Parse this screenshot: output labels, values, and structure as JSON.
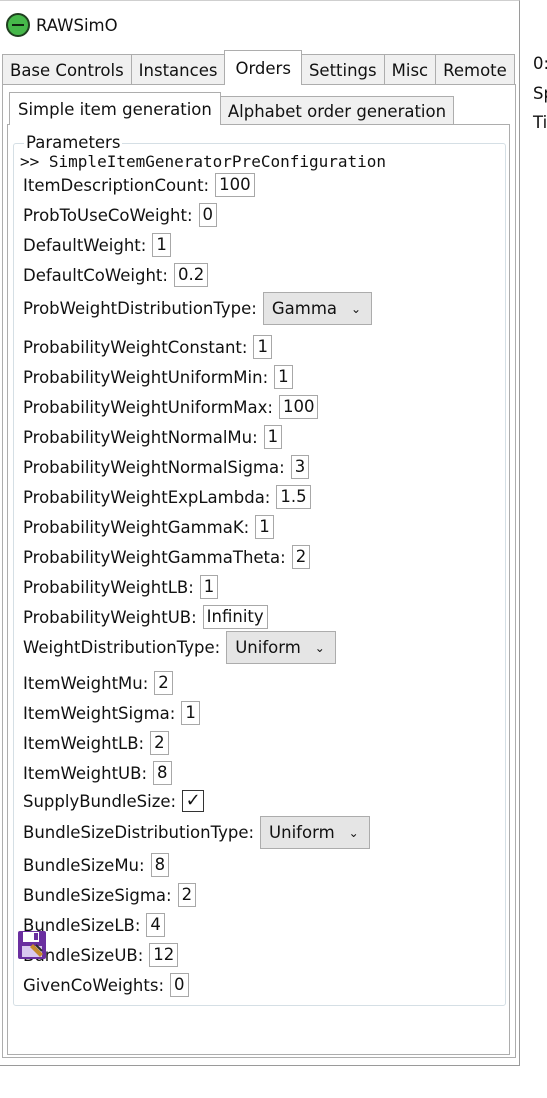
{
  "app": {
    "title": "RAWSimO"
  },
  "top_tabs": [
    "Base Controls",
    "Instances",
    "Orders",
    "Settings",
    "Misc",
    "Remote"
  ],
  "sub_tabs": [
    "Simple item generation",
    "Alphabet order generation"
  ],
  "group": {
    "legend": "Parameters",
    "config_header": ">> SimpleItemGeneratorPreConfiguration"
  },
  "params": {
    "item_description_count": {
      "label": "ItemDescriptionCount:",
      "value": "100"
    },
    "prob_to_use_co_weight": {
      "label": "ProbToUseCoWeight:",
      "value": "0"
    },
    "default_weight": {
      "label": "DefaultWeight:",
      "value": "1"
    },
    "default_co_weight": {
      "label": "DefaultCoWeight:",
      "value": "0.2"
    },
    "prob_weight_distribution_type": {
      "label": "ProbWeightDistributionType:",
      "value": "Gamma"
    },
    "probability_weight_constant": {
      "label": "ProbabilityWeightConstant:",
      "value": "1"
    },
    "probability_weight_uniform_min": {
      "label": "ProbabilityWeightUniformMin:",
      "value": "1"
    },
    "probability_weight_uniform_max": {
      "label": "ProbabilityWeightUniformMax:",
      "value": "100"
    },
    "probability_weight_normal_mu": {
      "label": "ProbabilityWeightNormalMu:",
      "value": "1"
    },
    "probability_weight_normal_sigma": {
      "label": "ProbabilityWeightNormalSigma:",
      "value": "3"
    },
    "probability_weight_exp_lambda": {
      "label": "ProbabilityWeightExpLambda:",
      "value": "1.5"
    },
    "probability_weight_gamma_k": {
      "label": "ProbabilityWeightGammaK:",
      "value": "1"
    },
    "probability_weight_gamma_theta": {
      "label": "ProbabilityWeightGammaTheta:",
      "value": "2"
    },
    "probability_weight_lb": {
      "label": "ProbabilityWeightLB:",
      "value": "1"
    },
    "probability_weight_ub": {
      "label": "ProbabilityWeightUB:",
      "value": "Infinity"
    },
    "weight_distribution_type": {
      "label": "WeightDistributionType:",
      "value": "Uniform"
    },
    "item_weight_mu": {
      "label": "ItemWeightMu:",
      "value": "2"
    },
    "item_weight_sigma": {
      "label": "ItemWeightSigma:",
      "value": "1"
    },
    "item_weight_lb": {
      "label": "ItemWeightLB:",
      "value": "2"
    },
    "item_weight_ub": {
      "label": "ItemWeightUB:",
      "value": "8"
    },
    "supply_bundle_size": {
      "label": "SupplyBundleSize:",
      "checked": true
    },
    "bundle_size_distribution_type": {
      "label": "BundleSizeDistributionType:",
      "value": "Uniform"
    },
    "bundle_size_mu": {
      "label": "BundleSizeMu:",
      "value": "8"
    },
    "bundle_size_sigma": {
      "label": "BundleSizeSigma:",
      "value": "2"
    },
    "bundle_size_lb": {
      "label": "BundleSizeLB:",
      "value": "4"
    },
    "bundle_size_ub": {
      "label": "BundleSizeUB:",
      "value": "12"
    },
    "given_co_weights": {
      "label": "GivenCoWeights:",
      "value": "0"
    }
  },
  "side_panel": {
    "lines": [
      "0:",
      "Sp",
      "Ti"
    ]
  },
  "icons": {
    "app": "raw-simo-app-icon",
    "save": "floppy-save-icon"
  },
  "colors": {
    "app_icon": "#46b84a",
    "save_icon": "#6a2fa0"
  }
}
